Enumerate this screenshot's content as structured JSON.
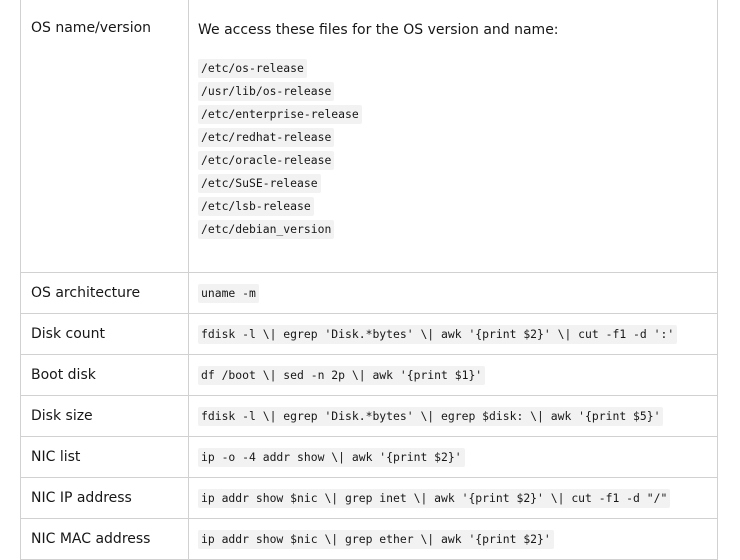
{
  "table": {
    "os_row": {
      "label": "OS name/version",
      "intro": "We access these files for the OS version and name:",
      "files": [
        "/etc/os-release",
        "/usr/lib/os-release",
        "/etc/enterprise-release",
        "/etc/redhat-release",
        "/etc/oracle-release",
        "/etc/SuSE-release",
        "/etc/lsb-release",
        "/etc/debian_version"
      ]
    },
    "rows": [
      {
        "label": "OS architecture",
        "command": "uname -m"
      },
      {
        "label": "Disk count",
        "command": "fdisk -l \\| egrep 'Disk.*bytes' \\| awk '{print $2}' \\| cut -f1 -d ':'"
      },
      {
        "label": "Boot disk",
        "command": "df /boot \\| sed -n 2p \\| awk '{print $1}'"
      },
      {
        "label": "Disk size",
        "command": "fdisk -l \\| egrep 'Disk.*bytes' \\| egrep $disk: \\| awk '{print $5}'"
      },
      {
        "label": "NIC list",
        "command": "ip -o -4 addr show \\| awk '{print $2}'"
      },
      {
        "label": "NIC IP address",
        "command": "ip addr show $nic \\| grep inet \\| awk '{print $2}' \\| cut -f1 -d \"/\""
      },
      {
        "label": "NIC MAC address",
        "command": "ip addr show $nic \\| grep ether \\| awk '{print $2}'"
      }
    ]
  }
}
